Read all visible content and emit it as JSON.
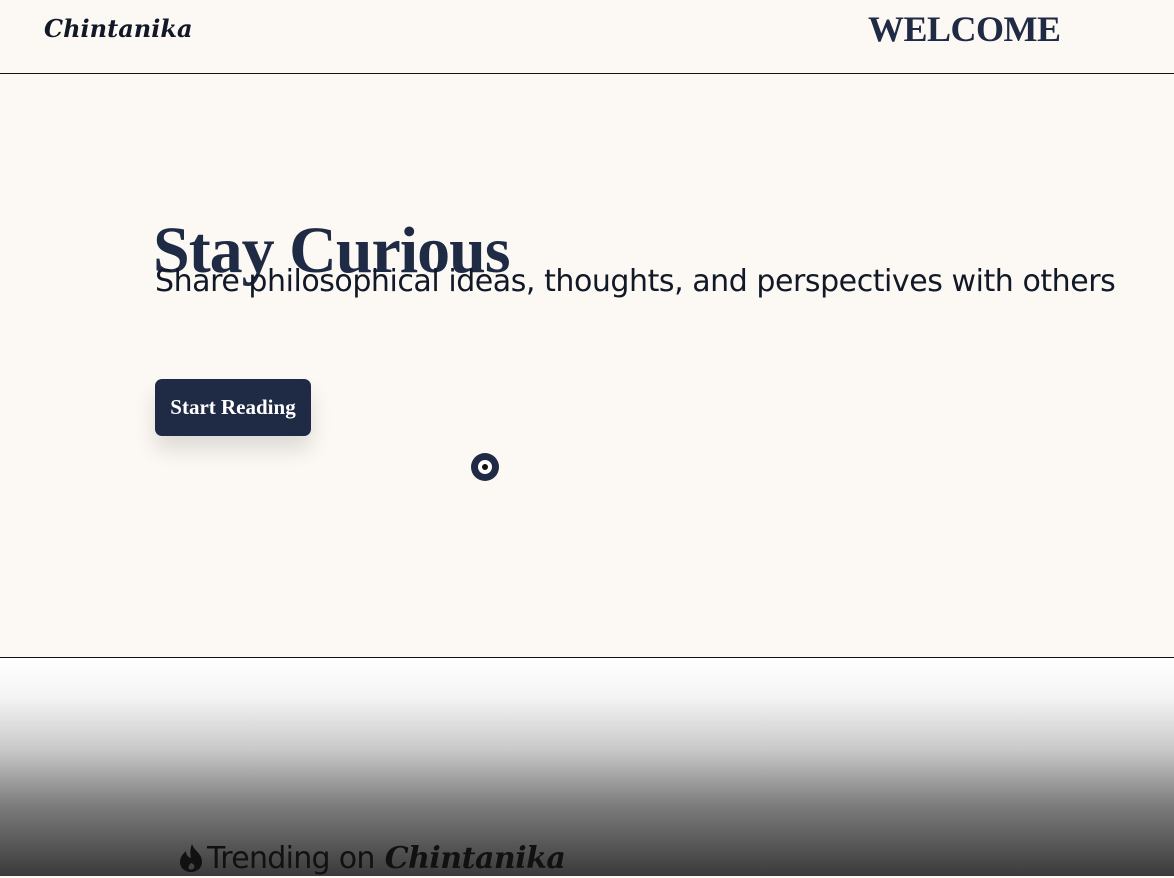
{
  "header": {
    "brand": "Chintanika",
    "welcome": "WELCOME"
  },
  "hero": {
    "title": "Stay Curious",
    "subtitle": "Share philosophical ideas, thoughts, and perspectives with others",
    "cta_label": "Start Reading"
  },
  "trending": {
    "label": "Trending on",
    "brand": "Chintanika",
    "icon": "flame-icon"
  },
  "colors": {
    "navy": "#1f2a44",
    "cream": "#fcf8f3",
    "text_dark": "#111827"
  }
}
